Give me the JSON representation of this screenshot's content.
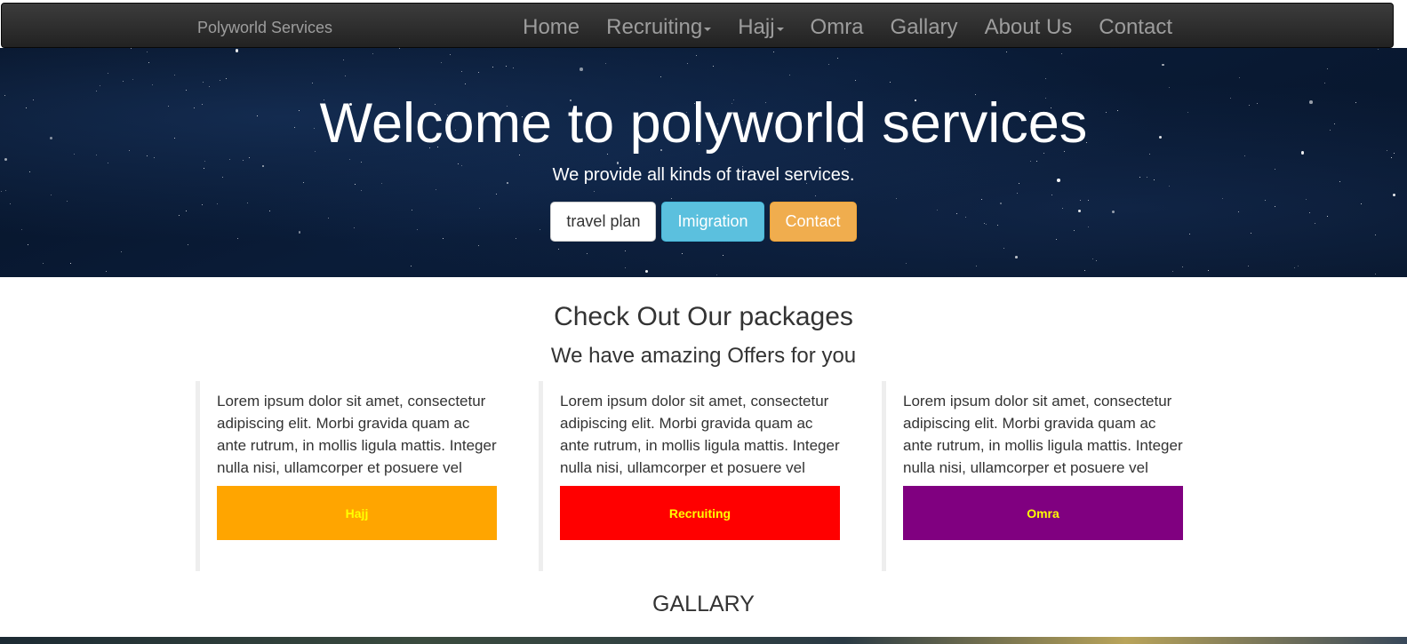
{
  "navbar": {
    "brand": "Polyworld Services",
    "items": [
      {
        "label": "Home",
        "dropdown": false
      },
      {
        "label": "Recruiting",
        "dropdown": true
      },
      {
        "label": "Hajj",
        "dropdown": true
      },
      {
        "label": "Omra",
        "dropdown": false
      },
      {
        "label": "Gallary",
        "dropdown": false
      },
      {
        "label": "About Us",
        "dropdown": false
      },
      {
        "label": "Contact",
        "dropdown": false
      }
    ]
  },
  "hero": {
    "title": "Welcome to polyworld services",
    "subtitle": "We provide all kinds of travel services.",
    "buttons": [
      {
        "label": "travel plan",
        "style": "default"
      },
      {
        "label": "Imigration",
        "style": "info"
      },
      {
        "label": "Contact",
        "style": "warning"
      }
    ]
  },
  "packages": {
    "title": "Check Out Our packages",
    "subtitle": "We have amazing Offers for you",
    "cards": [
      {
        "text": "Lorem ipsum dolor sit amet, consectetur adipiscing elit. Morbi gravida quam ac ante rutrum, in mollis ligula mattis. Integer nulla nisi, ullamcorper et posuere vel",
        "button": "Hajj",
        "color": "#ffa500"
      },
      {
        "text": "Lorem ipsum dolor sit amet, consectetur adipiscing elit. Morbi gravida quam ac ante rutrum, in mollis ligula mattis. Integer nulla nisi, ullamcorper et posuere vel",
        "button": "Recruiting",
        "color": "#ff0000"
      },
      {
        "text": "Lorem ipsum dolor sit amet, consectetur adipiscing elit. Morbi gravida quam ac ante rutrum, in mollis ligula mattis. Integer nulla nisi, ullamcorper et posuere vel",
        "button": "Omra",
        "color": "#800080"
      }
    ]
  },
  "gallary": {
    "title": "GALLARY"
  },
  "colors": {
    "navbar_bg": "#222222",
    "nav_text": "#9d9d9d",
    "button_text": "#ffff00"
  }
}
